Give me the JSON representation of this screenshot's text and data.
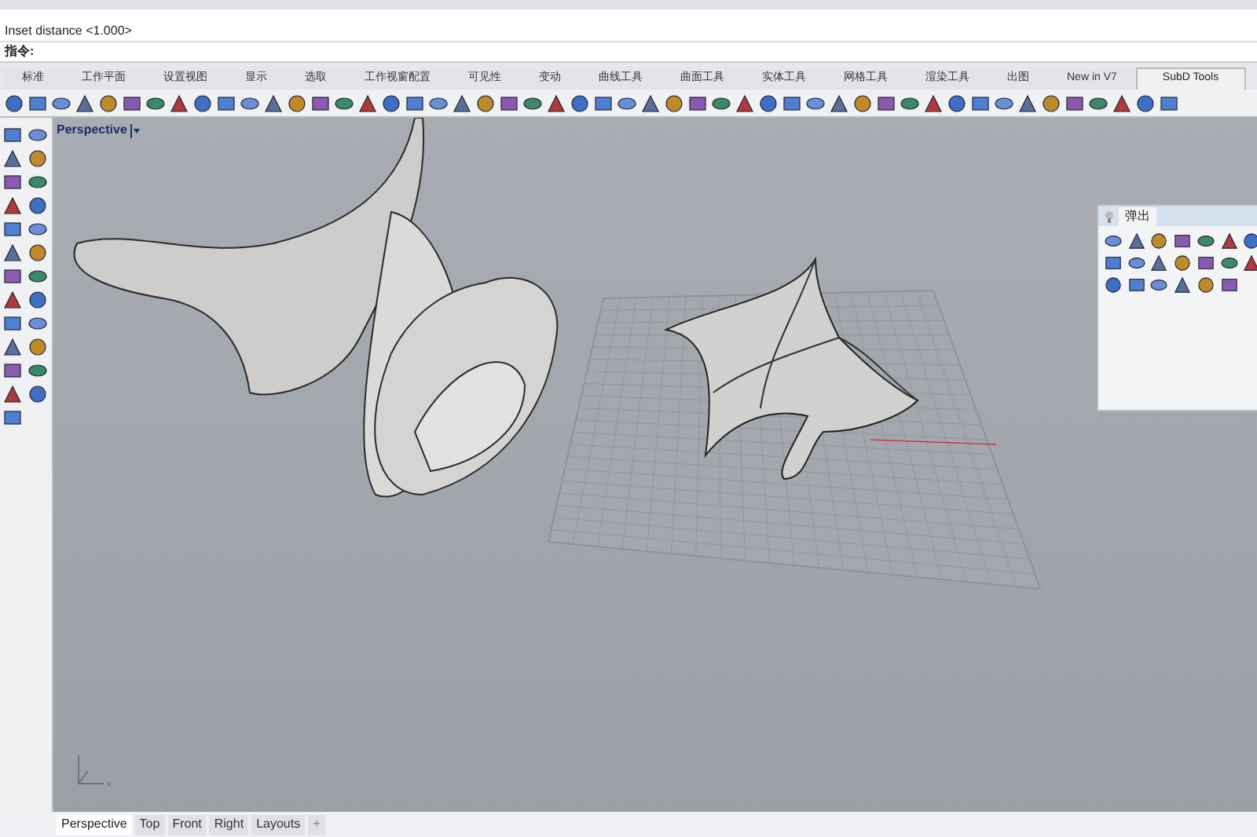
{
  "command_history": [
    "Inset distance <1.000>"
  ],
  "command_prompt": {
    "label": "指令:"
  },
  "toolbar_tabs": [
    {
      "label": "标准",
      "selected": false
    },
    {
      "label": "工作平面",
      "selected": false
    },
    {
      "label": "设置视图",
      "selected": false
    },
    {
      "label": "显示",
      "selected": false
    },
    {
      "label": "选取",
      "selected": false
    },
    {
      "label": "工作视窗配置",
      "selected": false
    },
    {
      "label": "可见性",
      "selected": false
    },
    {
      "label": "变动",
      "selected": false
    },
    {
      "label": "曲线工具",
      "selected": false
    },
    {
      "label": "曲面工具",
      "selected": false
    },
    {
      "label": "实体工具",
      "selected": false
    },
    {
      "label": "网格工具",
      "selected": false
    },
    {
      "label": "渲染工具",
      "selected": false
    },
    {
      "label": "出图",
      "selected": false
    },
    {
      "label": "New in V7",
      "selected": false
    },
    {
      "label": "SubD Tools",
      "selected": true
    }
  ],
  "viewport": {
    "title": "Perspective",
    "axis_label": "x"
  },
  "popup_panel": {
    "title": "弹出"
  },
  "view_tabs": [
    {
      "label": "Perspective",
      "selected": true
    },
    {
      "label": "Top",
      "selected": false
    },
    {
      "label": "Front",
      "selected": false
    },
    {
      "label": "Right",
      "selected": false
    },
    {
      "label": "Layouts",
      "selected": false
    }
  ],
  "add_tab": "+"
}
